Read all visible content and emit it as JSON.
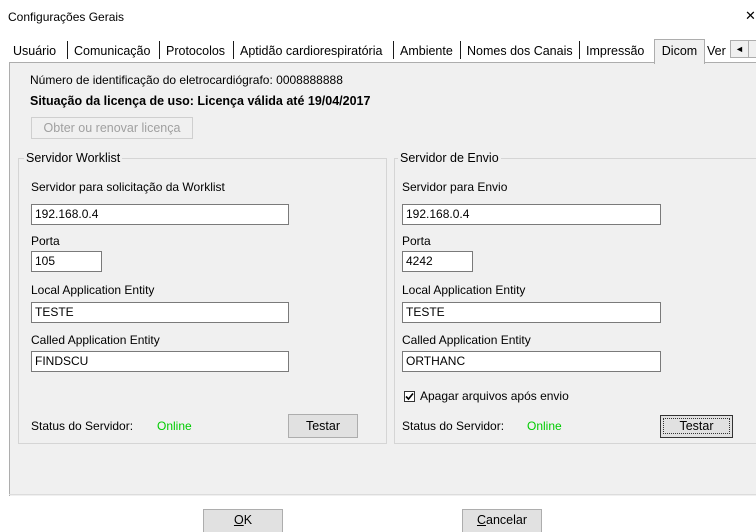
{
  "window": {
    "title": "Configurações Gerais",
    "close_glyph": "✕"
  },
  "tabs": [
    {
      "label": "Usuário"
    },
    {
      "label": "Comunicação"
    },
    {
      "label": "Protocolos"
    },
    {
      "label": "Aptidão cardiorespiratória"
    },
    {
      "label": "Ambiente"
    },
    {
      "label": "Nomes dos Canais"
    },
    {
      "label": "Impressão"
    },
    {
      "label": "Dicom",
      "active": true
    },
    {
      "label": "Ver"
    }
  ],
  "tab_scroll": {
    "left_icon": "◄"
  },
  "license": {
    "device_id_text": "Número de identificação do eletrocardiógrafo: 0008888888",
    "status_text": "Situação da licença de uso:  Licença válida até 19/04/2017",
    "renew_button": "Obter ou renovar licença"
  },
  "worklist": {
    "legend": "Servidor Worklist",
    "server_label": "Servidor para solicitação da Worklist",
    "server_value": "192.168.0.4",
    "port_label": "Porta",
    "port_value": "105",
    "local_ae_label": "Local Application Entity",
    "local_ae_value": "TESTE",
    "called_ae_label": "Called Application Entity",
    "called_ae_value": "FINDSCU",
    "status_label": "Status do Servidor:",
    "status_value": "Online",
    "test_button": "Testar"
  },
  "envio": {
    "legend": "Servidor de Envio",
    "server_label": "Servidor para Envio",
    "server_value": "192.168.0.4",
    "port_label": "Porta",
    "port_value": "4242",
    "local_ae_label": "Local Application Entity",
    "local_ae_value": "TESTE",
    "called_ae_label": "Called Application Entity",
    "called_ae_value": "ORTHANC",
    "delete_checkbox_label": "Apagar arquivos após envio",
    "delete_checkbox_checked": true,
    "status_label": "Status do Servidor:",
    "status_value": "Online",
    "test_button": "Testar"
  },
  "footer": {
    "ok_mnemonic": "O",
    "ok_rest": "K",
    "cancel_mnemonic": "C",
    "cancel_rest": "ancelar"
  },
  "colors": {
    "online": "#00cc00",
    "panel_bg": "#f0f0f0",
    "disabled_text": "#a0a0a0"
  }
}
